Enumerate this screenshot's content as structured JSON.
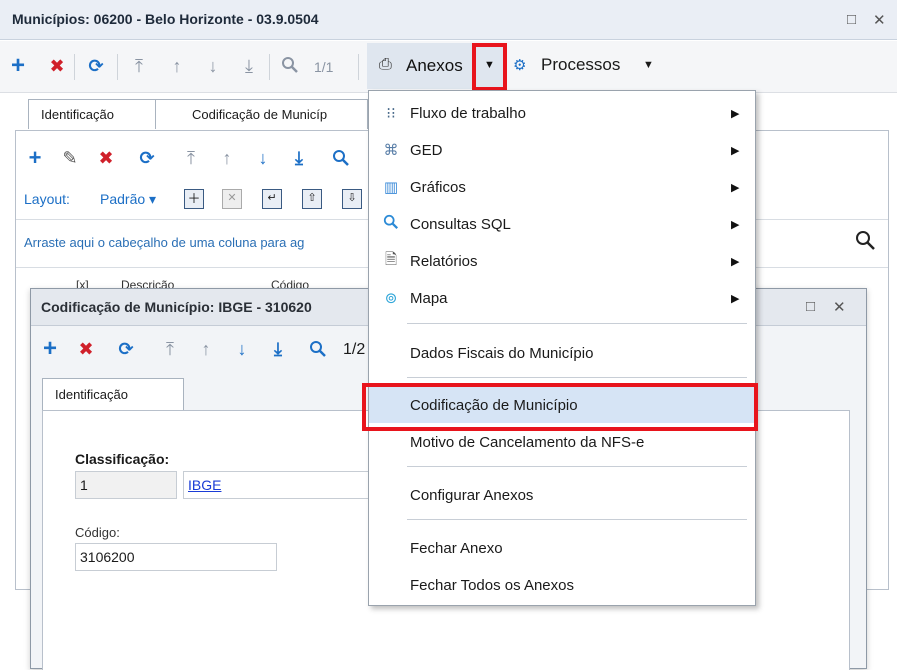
{
  "window": {
    "title": "Municípios: 06200 - Belo Horizonte - 03.9.0504",
    "maximize_icon": "□",
    "close_icon": "✕"
  },
  "toolbar": {
    "page_counter": "1/1",
    "anexos_label": "Anexos",
    "processos_label": "Processos"
  },
  "tabs": {
    "identificacao": "Identificação",
    "codificacao": "Codificação de Municíp"
  },
  "grid": {
    "layout_label": "Layout:",
    "layout_value": "Padrão",
    "drag_hint": "Arraste aqui o cabeçalho de uma coluna para ag",
    "col_desc": "Descrição",
    "col_cod": "Código",
    "col_check": "[x]"
  },
  "subwindow": {
    "title": "Codificação de Município: IBGE - 310620",
    "page_counter": "1/2",
    "tab_label": "Identificação",
    "classificacao_label": "Classificação:",
    "classificacao_value": "1",
    "classificacao_link": "IBGE",
    "codigo_label": "Código:",
    "codigo_value": "3106200"
  },
  "menu": {
    "items": [
      {
        "label": "Fluxo de trabalho",
        "icon": "workflow-icon",
        "submenu": true
      },
      {
        "label": "GED",
        "icon": "ged-icon",
        "submenu": true
      },
      {
        "label": "Gráficos",
        "icon": "chart-icon",
        "submenu": true
      },
      {
        "label": "Consultas SQL",
        "icon": "search-icon",
        "submenu": true
      },
      {
        "label": "Relatórios",
        "icon": "report-icon",
        "submenu": true
      },
      {
        "label": "Mapa",
        "icon": "map-pin-icon",
        "submenu": true
      },
      {
        "label": "Dados Fiscais do Município"
      },
      {
        "label": "Codificação de Município",
        "selected": true
      },
      {
        "label": "Motivo de Cancelamento da NFS-e"
      },
      {
        "label": "Configurar Anexos"
      },
      {
        "label": "Fechar Anexo"
      },
      {
        "label": "Fechar Todos os Anexos"
      }
    ]
  },
  "colors": {
    "highlight_border": "#e8141c",
    "selected_bg": "#d6e4f5",
    "accent": "#1c6fc6"
  }
}
